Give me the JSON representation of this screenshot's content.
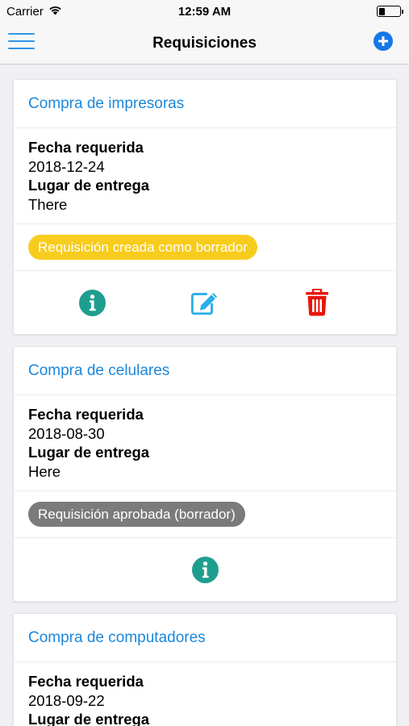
{
  "status_bar": {
    "carrier": "Carrier",
    "time": "12:59 AM",
    "battery_level": 0.3
  },
  "nav": {
    "title": "Requisiciones",
    "menu_icon": "hamburger-menu-icon",
    "add_icon": "plus-circle-icon",
    "accent_color": "#1677e6"
  },
  "labels": {
    "date_label": "Fecha requerida",
    "place_label": "Lugar de entrega"
  },
  "cards": [
    {
      "title": "Compra de impresoras",
      "date": "2018-12-24",
      "place": "There",
      "status": "Requisición creada como borrador",
      "status_color": "#f8cc1c",
      "actions": [
        "info",
        "edit",
        "delete"
      ]
    },
    {
      "title": "Compra de celulares",
      "date": "2018-08-30",
      "place": "Here",
      "status": "Requisición aprobada (borrador)",
      "status_color": "#7b7b7b",
      "actions": [
        "info"
      ]
    },
    {
      "title": "Compra de computadores",
      "date": "2018-09-22",
      "place": "",
      "status": "",
      "actions": []
    }
  ],
  "colors": {
    "title_blue": "#1b88db",
    "info_teal": "#1f9e8f",
    "edit_cyan": "#29aee6",
    "delete_red": "#e8160c"
  }
}
